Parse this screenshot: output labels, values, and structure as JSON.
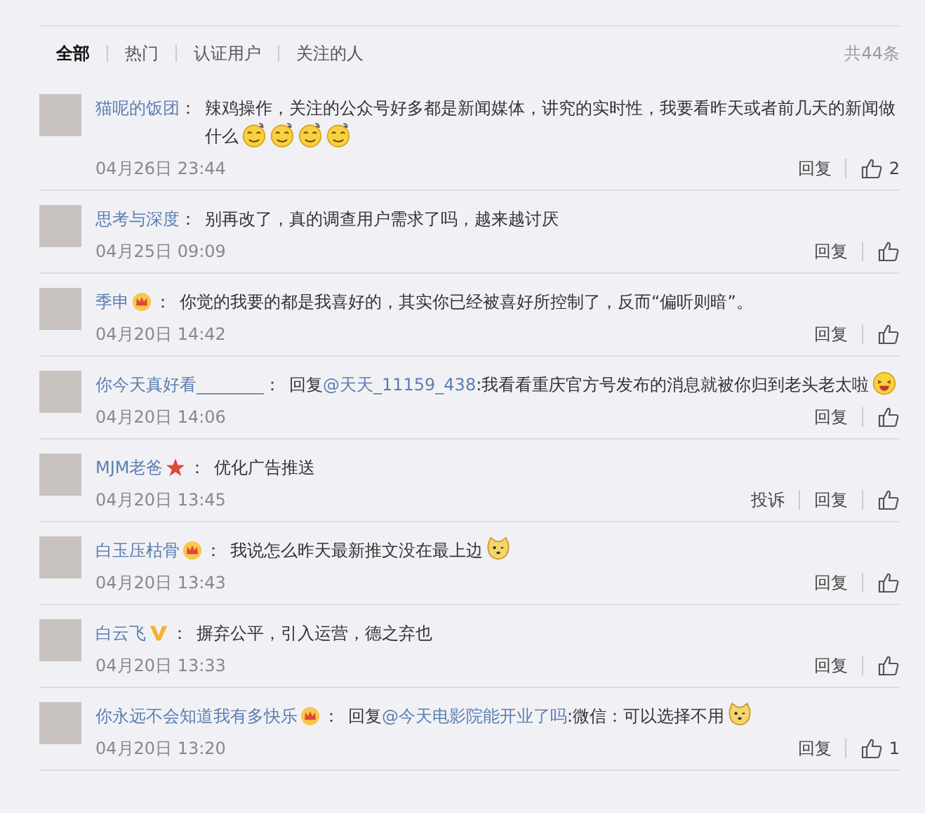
{
  "tabs": [
    {
      "label": "全部",
      "selected": true
    },
    {
      "label": "热门",
      "selected": false
    },
    {
      "label": "认证用户",
      "selected": false
    },
    {
      "label": "关注的人",
      "selected": false
    }
  ],
  "total": "共44条",
  "comments": [
    {
      "user": "猫呢的饭团",
      "sep": "：",
      "text": "辣鸡操作，关注的公众号好多都是新闻媒体，讲究的实时性，我要看昨天或者前几天的新闻做什么",
      "emojis": [
        {
          "kind": "dizzy"
        },
        {
          "kind": "dizzy"
        },
        {
          "kind": "dizzy"
        },
        {
          "kind": "dizzy"
        }
      ],
      "time": "04月26日 23:44",
      "actions": [
        "回复"
      ],
      "likes": "2"
    },
    {
      "user": "思考与深度",
      "sep": "：",
      "text": "别再改了，真的调查用户需求了吗，越来越讨厌",
      "time": "04月25日 09:09",
      "actions": [
        "回复"
      ]
    },
    {
      "user": "季申",
      "badge": {
        "kind": "crown"
      },
      "sep": "：",
      "text": "你觉的我要的都是我喜好的，其实你已经被喜好所控制了，反而“偏听则暗”。",
      "time": "04月20日 14:42",
      "actions": [
        "回复"
      ]
    },
    {
      "user": "你今天真好看________",
      "sep": "：",
      "reply": {
        "prefix": "回复",
        "mention": "@天天_11159_438"
      },
      "text": ":我看看重庆官方号发布的消息就被你归到老头老太啦",
      "emojis": [
        {
          "kind": "laugh"
        }
      ],
      "time": "04月20日 14:06",
      "actions": [
        "回复"
      ]
    },
    {
      "user": "MJM老爸",
      "badge": {
        "kind": "star"
      },
      "sep": "：",
      "text": "优化广告推送",
      "time": "04月20日 13:45",
      "actions": [
        "投诉",
        "回复"
      ]
    },
    {
      "user": "白玉压枯骨",
      "badge": {
        "kind": "crown"
      },
      "sep": "：",
      "text": "我说怎么昨天最新推文没在最上边",
      "emojis": [
        {
          "kind": "cat"
        }
      ],
      "time": "04月20日 13:43",
      "actions": [
        "回复"
      ]
    },
    {
      "user": "白云飞",
      "badge": {
        "kind": "v"
      },
      "sep": "：",
      "text": "摒弃公平，引入运营，德之弃也",
      "time": "04月20日 13:33",
      "actions": [
        "回复"
      ]
    },
    {
      "user": "你永远不会知道我有多快乐",
      "badge": {
        "kind": "crown"
      },
      "sep": "：",
      "reply": {
        "prefix": "回复",
        "mention": "@今天电影院能开业了吗"
      },
      "text": ":微信：可以选择不用",
      "emojis": [
        {
          "kind": "cat"
        }
      ],
      "time": "04月20日 13:20",
      "actions": [
        "回复"
      ],
      "likes": "1"
    }
  ]
}
